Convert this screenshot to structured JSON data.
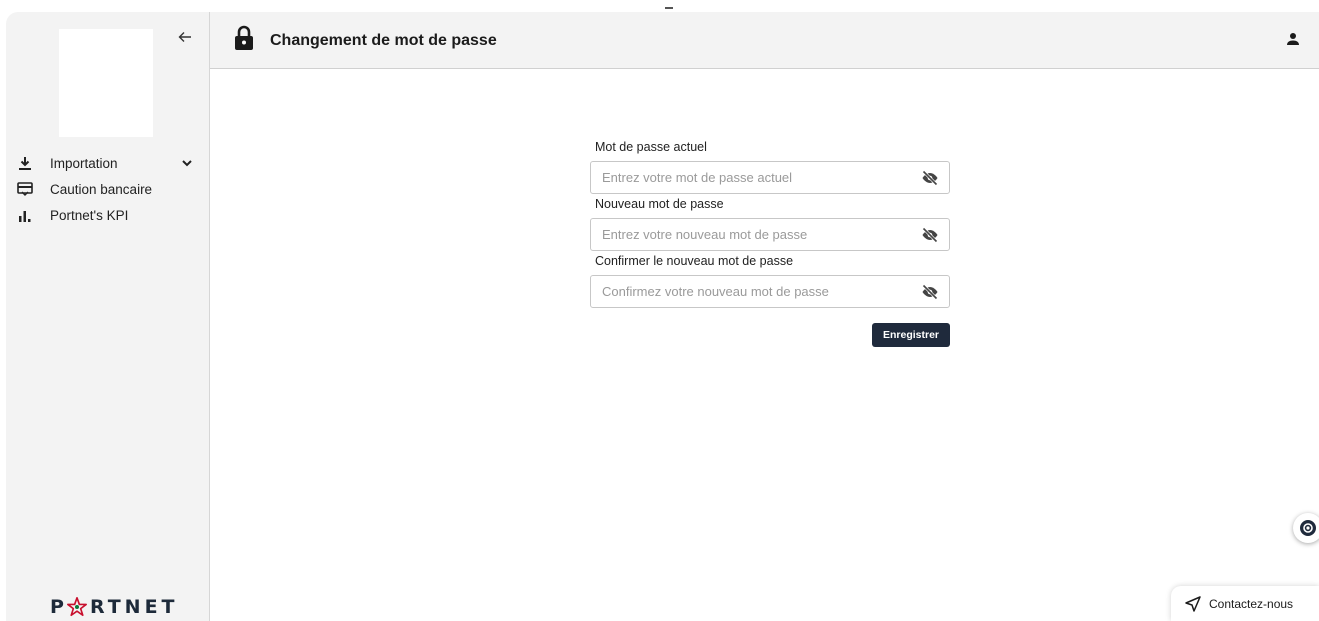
{
  "header": {
    "title": "Changement de mot de passe"
  },
  "sidebar": {
    "items": [
      {
        "label": "Importation",
        "icon": "download-icon",
        "expandable": true
      },
      {
        "label": "Caution bancaire",
        "icon": "credit-card-icon"
      },
      {
        "label": "Portnet's KPI",
        "icon": "bar-chart-icon"
      }
    ],
    "brand": {
      "before": "P",
      "after": "RTNET",
      "logo_icon": "star-icon"
    }
  },
  "form": {
    "fields": [
      {
        "label": "Mot de passe actuel",
        "placeholder": "Entrez votre mot de passe actuel"
      },
      {
        "label": "Nouveau mot de passe",
        "placeholder": "Entrez votre nouveau mot de passe"
      },
      {
        "label": "Confirmer le nouveau mot de passe",
        "placeholder": "Confirmez votre nouveau mot de passe"
      }
    ],
    "submit_label": "Enregistrer"
  },
  "widgets": {
    "contact_label": "Contactez-nous"
  },
  "colors": {
    "primary": "#1f2a3c",
    "sidebar_bg": "#f3f3f3",
    "brand_red": "#c8102e",
    "brand_green": "#0a7a3a"
  }
}
